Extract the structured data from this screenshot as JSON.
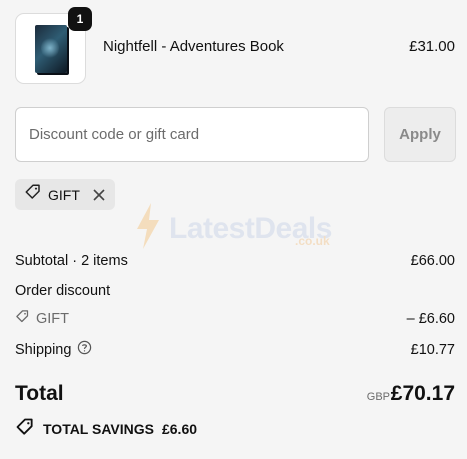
{
  "product": {
    "quantity": "1",
    "name": "Nightfell - Adventures Book",
    "price": "£31.00"
  },
  "discount": {
    "placeholder": "Discount code or gift card",
    "value": "",
    "apply_label": "Apply"
  },
  "applied_code": {
    "label": "GIFT"
  },
  "watermark": {
    "brand": "LatestDeals",
    "domain": ".co.uk"
  },
  "summary": {
    "subtotal_label": "Subtotal · 2 items",
    "subtotal_value": "£66.00",
    "order_discount_label": "Order discount",
    "discount_code": "GIFT",
    "discount_value": "– £6.60",
    "shipping_label": "Shipping",
    "shipping_value": "£10.77"
  },
  "total": {
    "label": "Total",
    "currency": "GBP",
    "value": "£70.17"
  },
  "savings": {
    "label": "TOTAL SAVINGS",
    "value": "£6.60"
  },
  "icons": {
    "tag": "tag-icon",
    "close": "close-icon",
    "help": "help-circle-icon",
    "savings": "savings-tag-icon",
    "bolt": "lightning-bolt-icon"
  }
}
